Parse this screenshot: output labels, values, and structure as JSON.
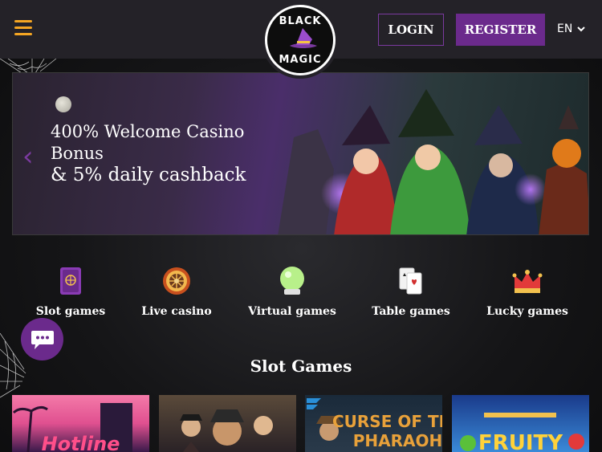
{
  "header": {
    "menu_icon": "hamburger-icon",
    "logo_top": "BLACK",
    "logo_bottom": "MAGIC",
    "login_label": "LOGIN",
    "register_label": "REGISTER",
    "language": "EN",
    "accent": "#6b2a8c",
    "menu_color": "#f5a623"
  },
  "banner": {
    "line1": "400% Welcome Casino",
    "line2": "Bonus",
    "line3": "& 5% daily cashback",
    "prev_icon": "chevron-left-icon"
  },
  "categories": [
    {
      "label": "Slot games",
      "icon": "spellbook-icon"
    },
    {
      "label": "Live casino",
      "icon": "roulette-icon"
    },
    {
      "label": "Virtual games",
      "icon": "crystal-ball-icon"
    },
    {
      "label": "Table games",
      "icon": "playing-cards-icon"
    },
    {
      "label": "Lucky games",
      "icon": "crown-icon"
    }
  ],
  "section_title": "Slot Games",
  "games": [
    {
      "title": "Hotline"
    },
    {
      "title": ""
    },
    {
      "title": "CURSE OF THE PHARAOH"
    },
    {
      "title": "FRUITY"
    }
  ],
  "chat_icon": "chat-bubble-icon"
}
